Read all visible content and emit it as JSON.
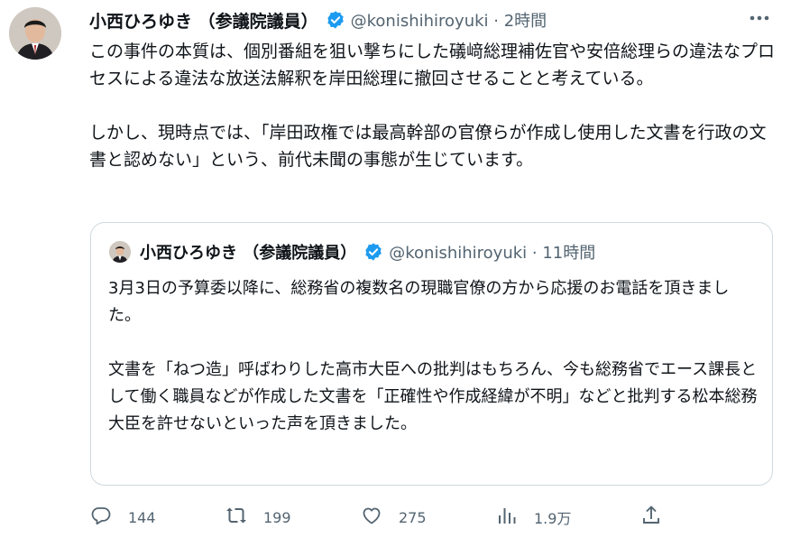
{
  "tweet": {
    "author_name": "小西ひろゆき （参議院議員）",
    "handle_time": "@konishihiroyuki · 2時間",
    "paragraphs": [
      "この事件の本質は、個別番組を狙い撃ちにした礒﨑総理補佐官や安倍総理らの違法なプロセスによる違法な放送法解釈を岸田総理に撤回させることと考えている。",
      "しかし、現時点では、「岸田政権では最高幹部の官僚らが作成し使用した文書を行政の文書と認めない」という、前代未聞の事態が生じています。"
    ]
  },
  "quoted": {
    "author_name": "小西ひろゆき （参議院議員）",
    "handle_time": "@konishihiroyuki · 11時間",
    "paragraphs": [
      "3月3日の予算委以降に、総務省の複数名の現職官僚の方から応援のお電話を頂きました。",
      "文書を「ねつ造」呼ばわりした高市大臣への批判はもちろん、今も総務省でエース課長として働く職員などが作成した文書を「正確性や作成経緯が不明」などと批判する松本総務大臣を許せないといった声を頂きました。"
    ]
  },
  "actions": {
    "replies": "144",
    "retweets": "199",
    "likes": "275",
    "views": "1.9万"
  },
  "icons": {
    "verified": "verified-badge-icon",
    "more": "more-dots-icon",
    "reply": "reply-icon",
    "retweet": "retweet-icon",
    "like": "heart-icon",
    "views": "views-chart-icon",
    "share": "share-icon"
  },
  "colors": {
    "verified": "#1d9bf0",
    "text": "#0f1419",
    "secondary": "#536471",
    "border": "#cfd9de"
  }
}
